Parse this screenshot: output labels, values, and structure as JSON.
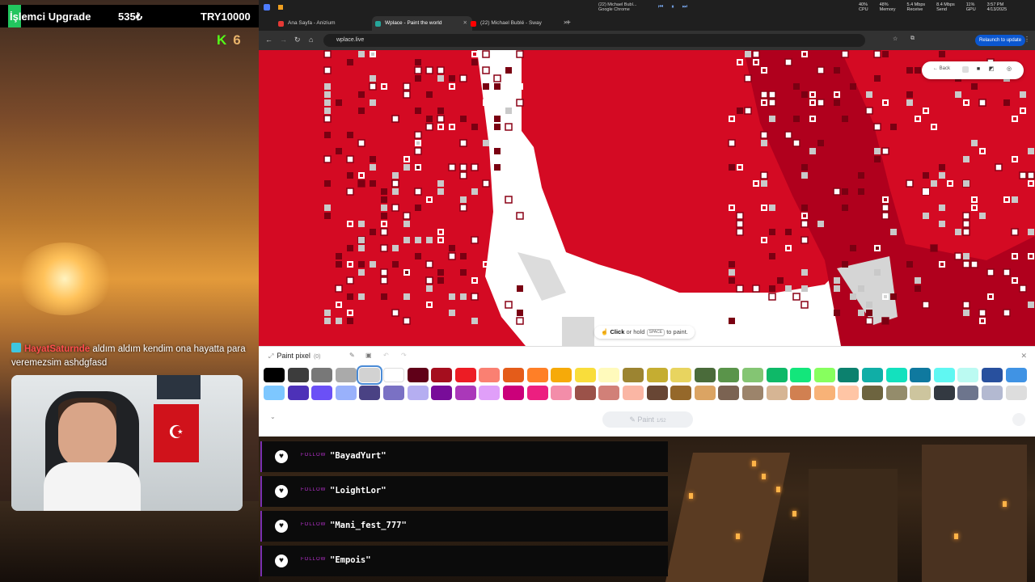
{
  "overlay": {
    "title": "İşlemci Upgrade",
    "amount": "535₺",
    "goal": "TRY10000",
    "kick_count": "6",
    "chat": {
      "username": "HayatSaturnde",
      "message": "aldım aldım kendim ona hayatta para veremezsim ashdgfasd"
    }
  },
  "browser": {
    "tabs": [
      {
        "label": "Ana Sayfa - Anizium",
        "color": "#e53935"
      },
      {
        "label": "Wplace - Paint the world",
        "color": "#26a69a"
      },
      {
        "label": "(22) Michael Bublé - Sway",
        "color": "#ff0000"
      }
    ],
    "media": {
      "title": "(22) Michael Bubl...",
      "source": "Google Chrome"
    },
    "stats": [
      {
        "value": "40%",
        "label": "CPU"
      },
      {
        "value": "48%",
        "label": "Memory"
      },
      {
        "value": "5.4 Mbps",
        "label": "Receive"
      },
      {
        "value": "8.4 Mbps",
        "label": "Send"
      },
      {
        "value": "11%",
        "label": "GPU"
      },
      {
        "value": "3:57 PM",
        "label": "4/13/2025"
      }
    ],
    "url": "wplace.live",
    "relaunch": "Relaunch to update"
  },
  "map": {
    "back_label": "Back",
    "hint_click": "Click",
    "hint_mid": "or hold",
    "hint_key": "SPACE",
    "hint_end": "to paint."
  },
  "palette": {
    "title": "Paint pixel",
    "count": "(0)",
    "paint_label": "Paint",
    "paint_sub": "1/52",
    "row1": [
      "#000000",
      "#3c3c3c",
      "#787878",
      "#aaaaaa",
      "#d2d2d2",
      "#ffffff",
      "#600018",
      "#a50e1e",
      "#ed1c24",
      "#fa8072",
      "#e45c1a",
      "#ff7f27",
      "#f6aa09",
      "#f9dd3b",
      "#fffabc",
      "#9c8431",
      "#c5ad31",
      "#e8d45f",
      "#4a6b3a",
      "#5a944a",
      "#84c573",
      "#0eb968",
      "#13e67b",
      "#87ff5e",
      "#0c816e",
      "#10aea6",
      "#13e1be",
      "#0f799f",
      "#60f7f2",
      "#bbfaf2",
      "#28509e",
      "#4093e4"
    ],
    "row2": [
      "#7dc7ff",
      "#4d31b8",
      "#6b50f6",
      "#99b1fb",
      "#4a4284",
      "#7a71c4",
      "#b5aef1",
      "#780c99",
      "#aa38b9",
      "#e09ff9",
      "#cb007a",
      "#ec1f80",
      "#f38da9",
      "#9b5249",
      "#d18078",
      "#fab6a4",
      "#684634",
      "#95682a",
      "#dba463",
      "#7b6352",
      "#9c846b",
      "#d6b594",
      "#d18051",
      "#f8b277",
      "#ffc5a5",
      "#6d643f",
      "#948c6b",
      "#cdc59e",
      "#333941",
      "#6d758d",
      "#b3b9d1",
      "#dddddd"
    ],
    "selected_index": 4
  },
  "follows": [
    {
      "label": "FOLLOW",
      "name": "\"BayadYurt\""
    },
    {
      "label": "FOLLOW",
      "name": "\"LoightLor\""
    },
    {
      "label": "FOLLOW",
      "name": "\"Mani_fest_777\""
    },
    {
      "label": "FOLLOW",
      "name": "\"Empois\""
    }
  ]
}
